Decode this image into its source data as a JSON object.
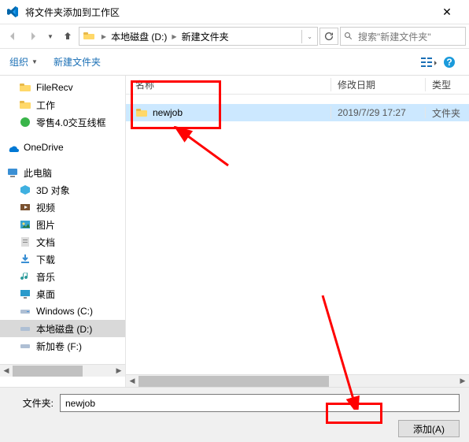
{
  "titlebar": {
    "title": "将文件夹添加到工作区"
  },
  "breadcrumb": {
    "drive": "本地磁盘 (D:)",
    "folder": "新建文件夹"
  },
  "search": {
    "placeholder": "搜索\"新建文件夹\""
  },
  "toolbar": {
    "organize": "组织",
    "newfolder": "新建文件夹"
  },
  "sidebar": {
    "items": [
      {
        "label": "FileRecv",
        "icon": "folder"
      },
      {
        "label": "工作",
        "icon": "folder"
      },
      {
        "label": "零售4.0交互线框",
        "icon": "green"
      }
    ],
    "onedrive": "OneDrive",
    "thispc": "此电脑",
    "pc_items": [
      {
        "label": "3D 对象",
        "icon": "3d"
      },
      {
        "label": "视频",
        "icon": "video"
      },
      {
        "label": "图片",
        "icon": "pictures"
      },
      {
        "label": "文档",
        "icon": "docs"
      },
      {
        "label": "下载",
        "icon": "downloads"
      },
      {
        "label": "音乐",
        "icon": "music"
      },
      {
        "label": "桌面",
        "icon": "desktop"
      },
      {
        "label": "Windows (C:)",
        "icon": "drive"
      },
      {
        "label": "本地磁盘 (D:)",
        "icon": "drive",
        "selected": true
      },
      {
        "label": "新加卷 (F:)",
        "icon": "drive"
      }
    ]
  },
  "columns": {
    "name": "名称",
    "date": "修改日期",
    "type": "类型"
  },
  "files": [
    {
      "name": "newjob",
      "date": "2019/7/29 17:27",
      "type": "文件夹",
      "selected": true
    }
  ],
  "bottom": {
    "label": "文件夹:",
    "value": "newjob",
    "add": "添加(A)"
  }
}
